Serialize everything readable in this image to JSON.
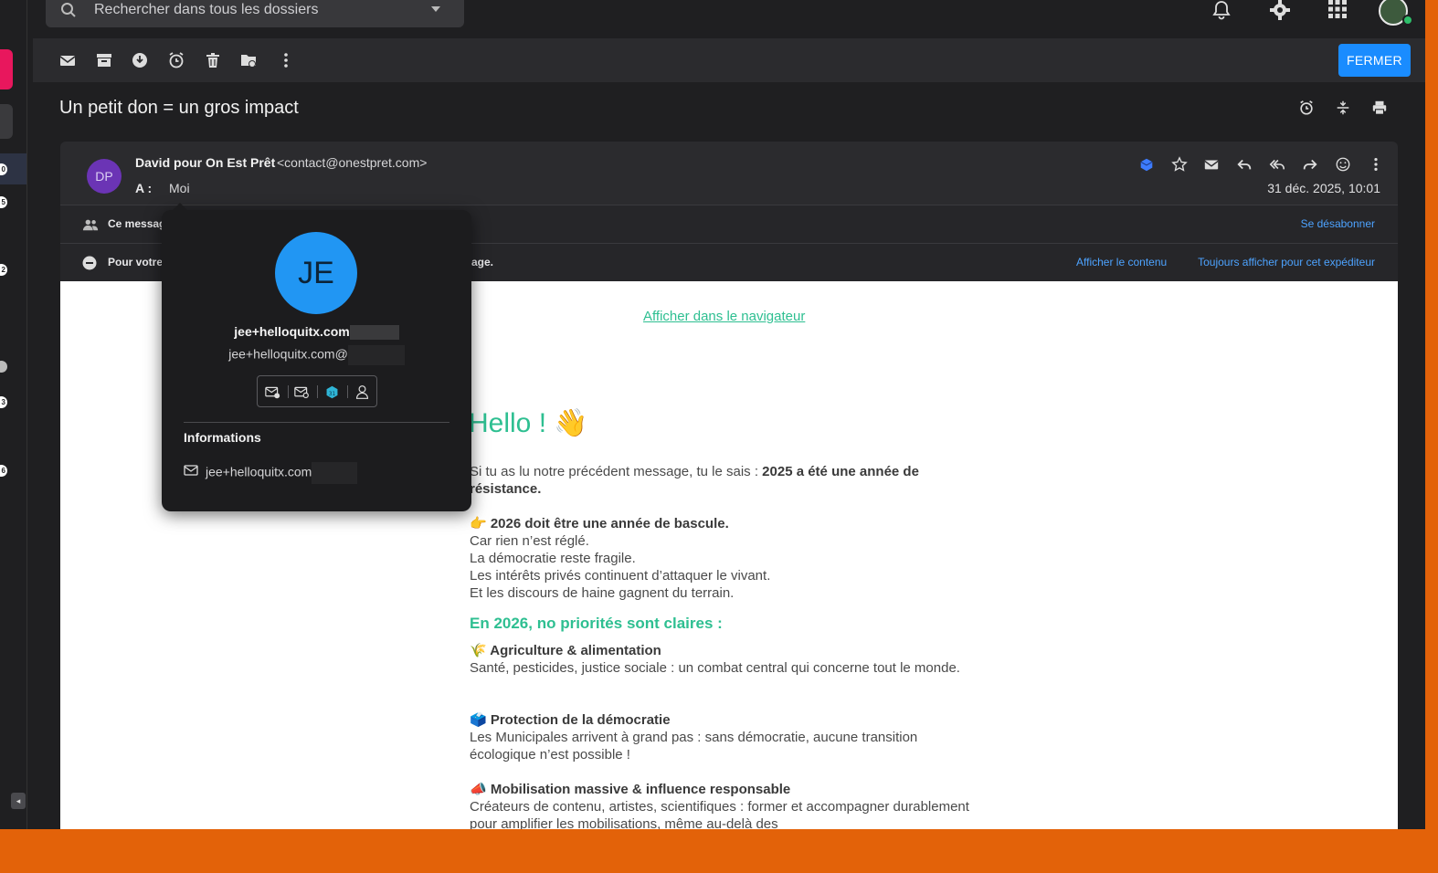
{
  "search": {
    "placeholder": "Rechercher dans tous les dossiers"
  },
  "toolbar": {
    "close_label": "FERMER"
  },
  "message": {
    "subject": "Un petit don = un gros impact",
    "sender_initials": "DP",
    "sender_name": "David pour On Est Prêt",
    "sender_email": "<contact@onestpret.com>",
    "to_label": "A :",
    "to_value": "Moi",
    "date": "31 déc. 2025, 10:01"
  },
  "notices": {
    "mailing_text": "Ce messag",
    "unsubscribe": "Se désabonner",
    "privacy_text_start": "Pour votre",
    "privacy_text_end": "age.",
    "show_content": "Afficher le contenu",
    "always_show": "Toujours afficher pour cet expéditeur"
  },
  "email_body": {
    "view_in_browser": "Afficher dans le navigateur",
    "hello": "Hello ! 👋",
    "intro": "Si tu as lu notre précédent message, tu le sais : ",
    "intro_bold": "2025 a été une année de résistance.",
    "tipping_heading": "👉 2026 doit être une année de bascule.",
    "tipping_lines": [
      "Car rien n’est réglé.",
      "La démocratie reste fragile.",
      "Les intérêts privés continuent d’attaquer le vivant.",
      "Et les discours de haine gagnent du terrain."
    ],
    "priorities_heading": "En 2026, no priorités sont claires :",
    "agri_heading": "🌾 Agriculture & alimentation",
    "agri_text": "Santé, pesticides, justice sociale : un combat central qui concerne tout le monde.",
    "demo_heading": "🗳️ Protection de la démocratie",
    "demo_text": "Les Municipales arrivent à grand pas : sans démocratie, aucune transition écologique n’est possible !",
    "mobil_heading": "📣 Mobilisation massive & influence responsable",
    "mobil_text": "Créateurs de contenu, artistes, scientifiques : former et accompagner durablement pour amplifier les mobilisations, même au-delà des"
  },
  "popover": {
    "initials": "JE",
    "name": "jee+helloquitx.com",
    "email": "jee+helloquitx.com@",
    "info_title": "Informations",
    "info_email": "jee+helloquitx.com"
  },
  "left_rail_badges": [
    "0",
    "5",
    "2",
    "3",
    "6"
  ],
  "colors": {
    "accent_blue": "#1a8cff",
    "email_green": "#2ebf91",
    "avatar_purple": "#6b34b5",
    "contact_avatar": "#2196f3",
    "outer_bg": "#e36209"
  }
}
